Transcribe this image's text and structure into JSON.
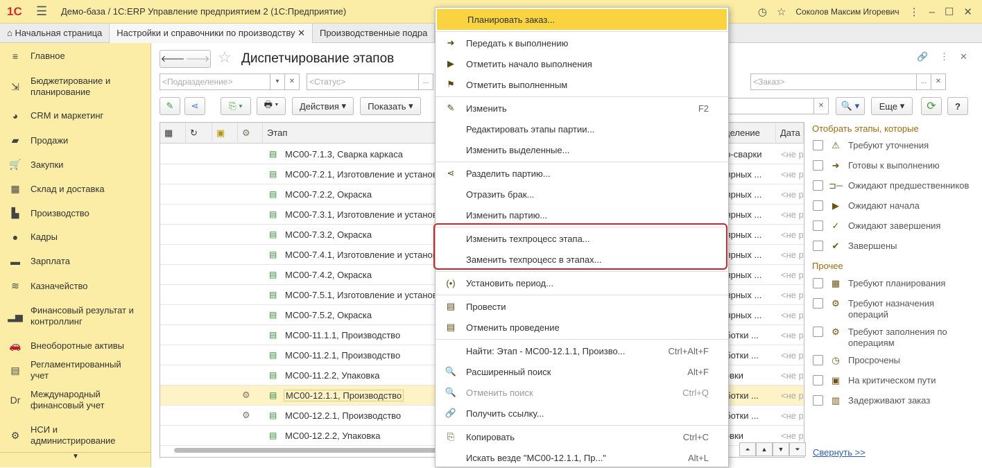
{
  "app": {
    "logo": "1С",
    "title": "Демо-база / 1С:ERP Управление предприятием 2  (1С:Предприятие)",
    "user": "Соколов Максим Игоревич"
  },
  "tabs": [
    {
      "label": "Начальная страница"
    },
    {
      "label": "Настройки и справочники по производству"
    },
    {
      "label": "Производственные подра"
    }
  ],
  "sidebar": {
    "items": [
      {
        "icon": "menu-icon",
        "label": "Главное"
      },
      {
        "icon": "budget-icon",
        "label": "Бюджетирование и планирование"
      },
      {
        "icon": "pie-icon",
        "label": "CRM и маркетинг"
      },
      {
        "icon": "bag-icon",
        "label": "Продажи"
      },
      {
        "icon": "cart-icon",
        "label": "Закупки"
      },
      {
        "icon": "warehouse-icon",
        "label": "Склад и доставка"
      },
      {
        "icon": "factory-icon",
        "label": "Производство"
      },
      {
        "icon": "person-icon",
        "label": "Кадры"
      },
      {
        "icon": "wallet-icon",
        "label": "Зарплата"
      },
      {
        "icon": "coins-icon",
        "label": "Казначейство"
      },
      {
        "icon": "chart-icon",
        "label": "Финансовый результат и контроллинг"
      },
      {
        "icon": "car-icon",
        "label": "Внеоборотные активы"
      },
      {
        "icon": "book-icon",
        "label": "Регламентированный учет"
      },
      {
        "icon": "drcr-icon",
        "label": "Международный финансовый учет"
      },
      {
        "icon": "gear-icon",
        "label": "НСИ и администрирование"
      }
    ]
  },
  "page": {
    "title": "Диспетчирование этапов",
    "filters": {
      "department": "<Подразделение>",
      "status": "<Статус>",
      "order": "<Заказ>"
    },
    "toolbar": {
      "actions": "Действия",
      "show": "Показать",
      "more": "Еще",
      "help": "?"
    },
    "columns": {
      "stage": "Этап",
      "department": "деление",
      "date": "Дата"
    },
    "rows": [
      {
        "name": "МС00-7.1.3, Сварка каркаса",
        "dept": "ро-сварки",
        "date": "<не р"
      },
      {
        "name": "МС00-7.2.1, Изготовление и установка",
        "dept": "лярных ...",
        "date": "<не р"
      },
      {
        "name": "МС00-7.2.2, Окраска",
        "dept": "лярных ...",
        "date": "<не р"
      },
      {
        "name": "МС00-7.3.1, Изготовление и установка",
        "dept": "лярных ...",
        "date": "<не р"
      },
      {
        "name": "МС00-7.3.2, Окраска",
        "dept": "лярных ...",
        "date": "<не р"
      },
      {
        "name": "МС00-7.4.1, Изготовление и установка",
        "dept": "лярных ...",
        "date": "<не р"
      },
      {
        "name": "МС00-7.4.2, Окраска",
        "dept": "лярных ...",
        "date": "<не р"
      },
      {
        "name": "МС00-7.5.1, Изготовление и установка",
        "dept": "лярных ...",
        "date": "<не р"
      },
      {
        "name": "МС00-7.5.2, Окраска",
        "dept": "лярных ...",
        "date": "<не р"
      },
      {
        "name": "МС00-11.1.1, Производство",
        "dept": "аботки ...",
        "date": "<не р"
      },
      {
        "name": "МС00-11.2.1, Производство",
        "dept": "аботки ...",
        "date": "<не р"
      },
      {
        "name": "МС00-11.2.2, Упаковка",
        "dept": "ковки",
        "date": "<не р"
      },
      {
        "name": "МС00-12.1.1, Производство",
        "dept": "аботки ...",
        "date": "<не р",
        "selected": true,
        "gear": true
      },
      {
        "name": "МС00-12.2.1, Производство",
        "dept": "аботки ...",
        "date": "<не р",
        "gear": true
      },
      {
        "name": "МС00-12.2.2, Упаковка",
        "dept": "ковки",
        "date": "<не р"
      }
    ]
  },
  "right_panel": {
    "header": "Отобрать этапы, которые",
    "items": [
      "Требуют уточнения",
      "Готовы к выполнению",
      "Ожидают предшественников",
      "Ожидают начала",
      "Ожидают завершения",
      "Завершены"
    ],
    "other_header": "Прочее",
    "other": [
      "Требуют планирования",
      "Требуют назначения операций",
      "Требуют заполнения по операциям",
      "Просрочены",
      "На критическом пути",
      "Задерживают заказ"
    ],
    "collapse": "Свернуть >>"
  },
  "context_menu": [
    {
      "label": "Планировать заказ...",
      "icon": "",
      "highlighted": true
    },
    {
      "sep": true
    },
    {
      "label": "Передать к выполнению",
      "icon": "➜"
    },
    {
      "label": "Отметить начало выполнения",
      "icon": "▶"
    },
    {
      "label": "Отметить выполненным",
      "icon": "⚑"
    },
    {
      "sep": true
    },
    {
      "label": "Изменить",
      "icon": "✎",
      "shortcut": "F2"
    },
    {
      "label": "Редактировать этапы партии...",
      "icon": ""
    },
    {
      "label": "Изменить выделенные...",
      "icon": ""
    },
    {
      "sep": true
    },
    {
      "label": "Разделить партию...",
      "icon": "⋖"
    },
    {
      "label": "Отразить брак...",
      "icon": ""
    },
    {
      "label": "Изменить партию...",
      "icon": ""
    },
    {
      "sep": true
    },
    {
      "label": "Изменить техпроцесс этапа...",
      "icon": ""
    },
    {
      "label": "Заменить техпроцесс в этапах...",
      "icon": ""
    },
    {
      "sep": true
    },
    {
      "label": "Установить период...",
      "icon": "(•)"
    },
    {
      "sep": true
    },
    {
      "label": "Провести",
      "icon": "▤"
    },
    {
      "label": "Отменить проведение",
      "icon": "▤"
    },
    {
      "sep": true
    },
    {
      "label": "Найти: Этап - МС00-12.1.1, Произво...",
      "icon": "",
      "shortcut": "Ctrl+Alt+F"
    },
    {
      "label": "Расширенный поиск",
      "icon": "🔍",
      "shortcut": "Alt+F"
    },
    {
      "label": "Отменить поиск",
      "icon": "🔍",
      "shortcut": "Ctrl+Q",
      "disabled": true
    },
    {
      "label": "Получить ссылку...",
      "icon": "🔗"
    },
    {
      "sep": true
    },
    {
      "label": "Копировать",
      "icon": "⎘",
      "shortcut": "Ctrl+C"
    },
    {
      "label": "Искать везде \"МС00-12.1.1, Пр...\"",
      "icon": "",
      "shortcut": "Alt+L"
    }
  ]
}
